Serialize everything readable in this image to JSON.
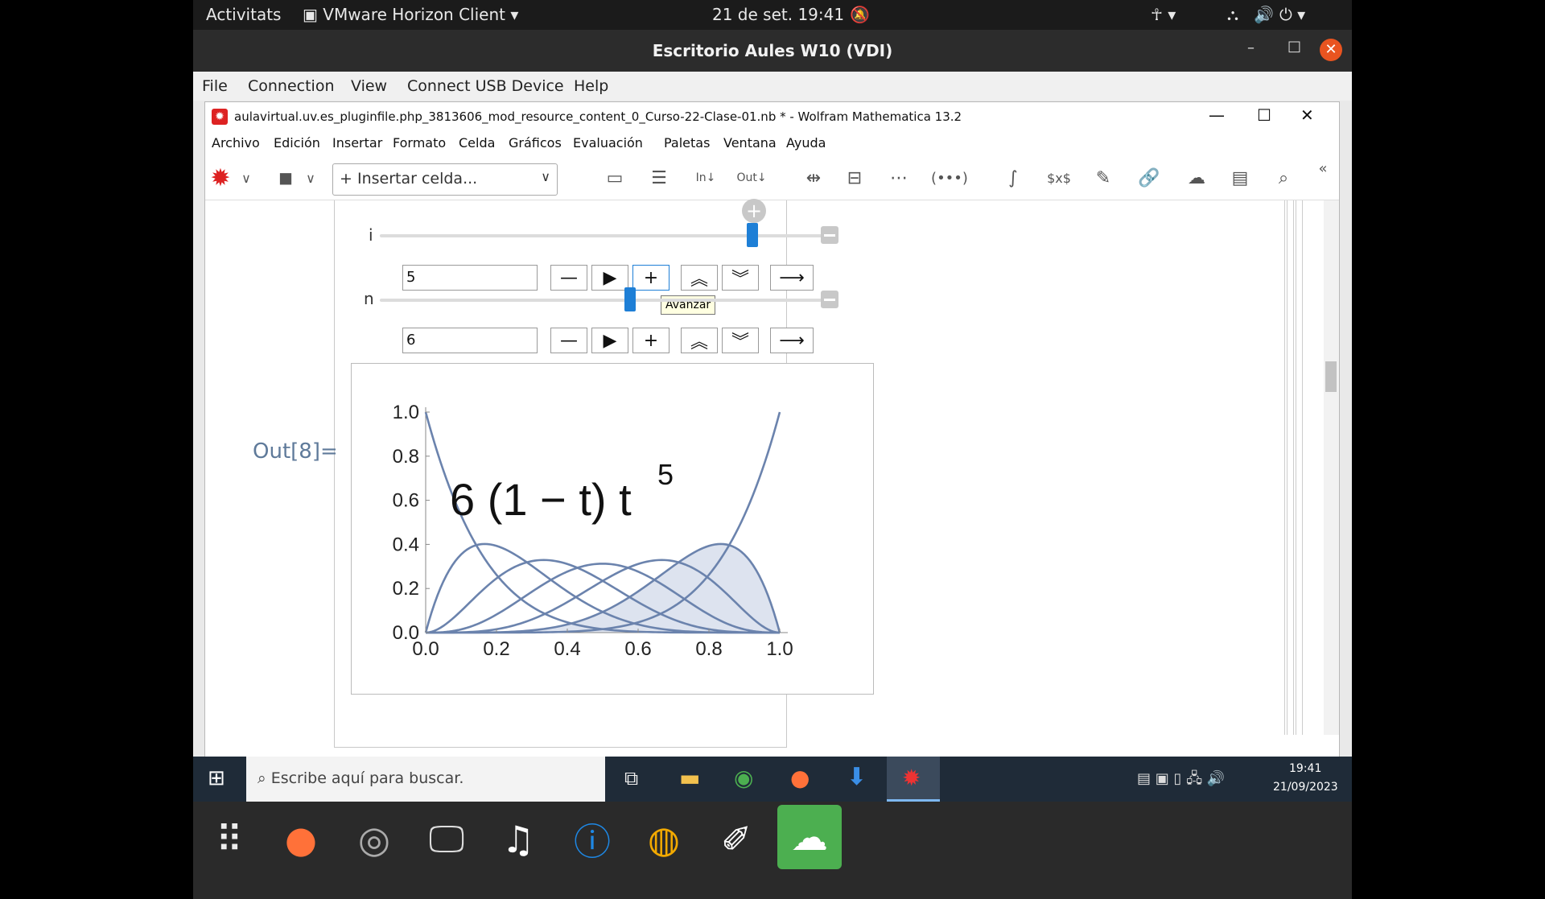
{
  "topbar": {
    "activities": "Activitats",
    "app": "VMware Horizon Client",
    "datetime": "21 de set.  19:41"
  },
  "vm": {
    "title": "Escritorio Aules W10 (VDI)",
    "menu": [
      "File",
      "Connection",
      "View",
      "Connect USB Device",
      "Help"
    ]
  },
  "mathematica": {
    "title": "aulavirtual.uv.es_pluginfile.php_3813606_mod_resource_content_0_Curso-22-Clase-01.nb * - Wolfram Mathematica 13.2",
    "menu": [
      "Archivo",
      "Edición",
      "Insertar",
      "Formato",
      "Celda",
      "Gráficos",
      "Evaluación",
      "Paletas",
      "Ventana",
      "Ayuda"
    ],
    "insert_cell": "Insertar celda...",
    "toolbar_in": "In",
    "toolbar_out": "Out"
  },
  "manipulate": {
    "i": {
      "label": "i",
      "value": "5",
      "slider_fraction": 0.82
    },
    "n": {
      "label": "n",
      "value": "6",
      "slider_fraction": 0.55
    },
    "tooltip": "Avanzar",
    "out_label": "Out[8]="
  },
  "chart_data": {
    "type": "area",
    "title": "",
    "annotation": "6 (1 − t) t",
    "annotation_sup": "5",
    "xlim": [
      0,
      1
    ],
    "ylim": [
      0,
      1
    ],
    "x_ticks": [
      "0.0",
      "0.2",
      "0.4",
      "0.6",
      "0.8",
      "1.0"
    ],
    "y_ticks": [
      "0.0",
      "0.2",
      "0.4",
      "0.6",
      "0.8",
      "1.0"
    ],
    "curves": "Bernstein basis polynomials of degree 6, k = 0..6; k = 5 filled",
    "degree": 6,
    "highlight_k": 5,
    "line_color": "#6b83ad",
    "fill_color": "#dde3ef"
  },
  "taskbar": {
    "search_placeholder": "Escribe aquí para buscar.",
    "time": "19:41",
    "date": "21/09/2023"
  }
}
